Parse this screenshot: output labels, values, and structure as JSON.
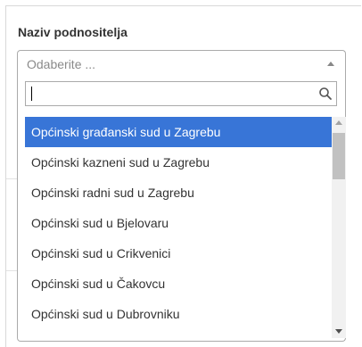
{
  "field": {
    "label": "Naziv podnositelja"
  },
  "select": {
    "placeholder": "Odaberite ...",
    "search_value": ""
  },
  "options": [
    {
      "label": "Općinski građanski sud u Zagrebu",
      "highlighted": true
    },
    {
      "label": "Općinski kazneni sud u Zagrebu",
      "highlighted": false
    },
    {
      "label": "Općinski radni sud u Zagrebu",
      "highlighted": false
    },
    {
      "label": "Općinski sud u Bjelovaru",
      "highlighted": false
    },
    {
      "label": "Općinski sud u Crikvenici",
      "highlighted": false
    },
    {
      "label": "Općinski sud u Čakovcu",
      "highlighted": false
    },
    {
      "label": "Općinski sud u Dubrovniku",
      "highlighted": false
    }
  ],
  "colors": {
    "highlight": "#3875d7",
    "text": "#333333",
    "border": "#aaaaaa"
  },
  "icons": {
    "search": "search-icon",
    "dropdown_arrow": "chevron-up-icon"
  }
}
